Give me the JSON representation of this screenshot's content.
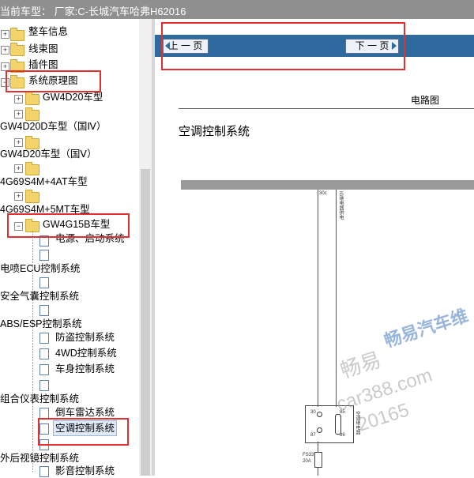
{
  "header": {
    "text": "当前车型：  厂家:C-长城汽车哈弗H62016"
  },
  "tree": {
    "items": [
      "整车信息",
      "线束图",
      "插件图",
      "系统原理图",
      "GW4D20车型",
      "GW4D20D车型（国Ⅳ）",
      "GW4D20车型（国Ⅴ）",
      "4G69S4M+4AT车型",
      "4G69S4M+5MT车型",
      "GW4G15B车型",
      "电源、启动系统",
      "电喷ECU控制系统",
      "安全气囊控制系统",
      "ABS/ESP控制系统",
      "防盗控制系统",
      "4WD控制系统",
      "车身控制系统",
      "组合仪表控制系统",
      "倒车雷达系统",
      "空调控制系统",
      "外后视镜控制系统",
      "影音控制系统"
    ]
  },
  "nav": {
    "prev": "上 一 页",
    "next": "下 一 页"
  },
  "page": {
    "diagram_title": "电路图",
    "system_title": "空调控制系统"
  },
  "diagram": {
    "wire_label_1": "30c",
    "wire_label_2": "IG继电器供电",
    "relay_pins": [
      "30",
      "85",
      "87",
      "86"
    ],
    "relay_label": "空调继电器",
    "fuse": "FS33",
    "fuse_rating": "20A"
  },
  "watermark": {
    "brand": "畅易汽车维",
    "cn": "畅易",
    "site": "car388.com",
    "num": "20165"
  }
}
